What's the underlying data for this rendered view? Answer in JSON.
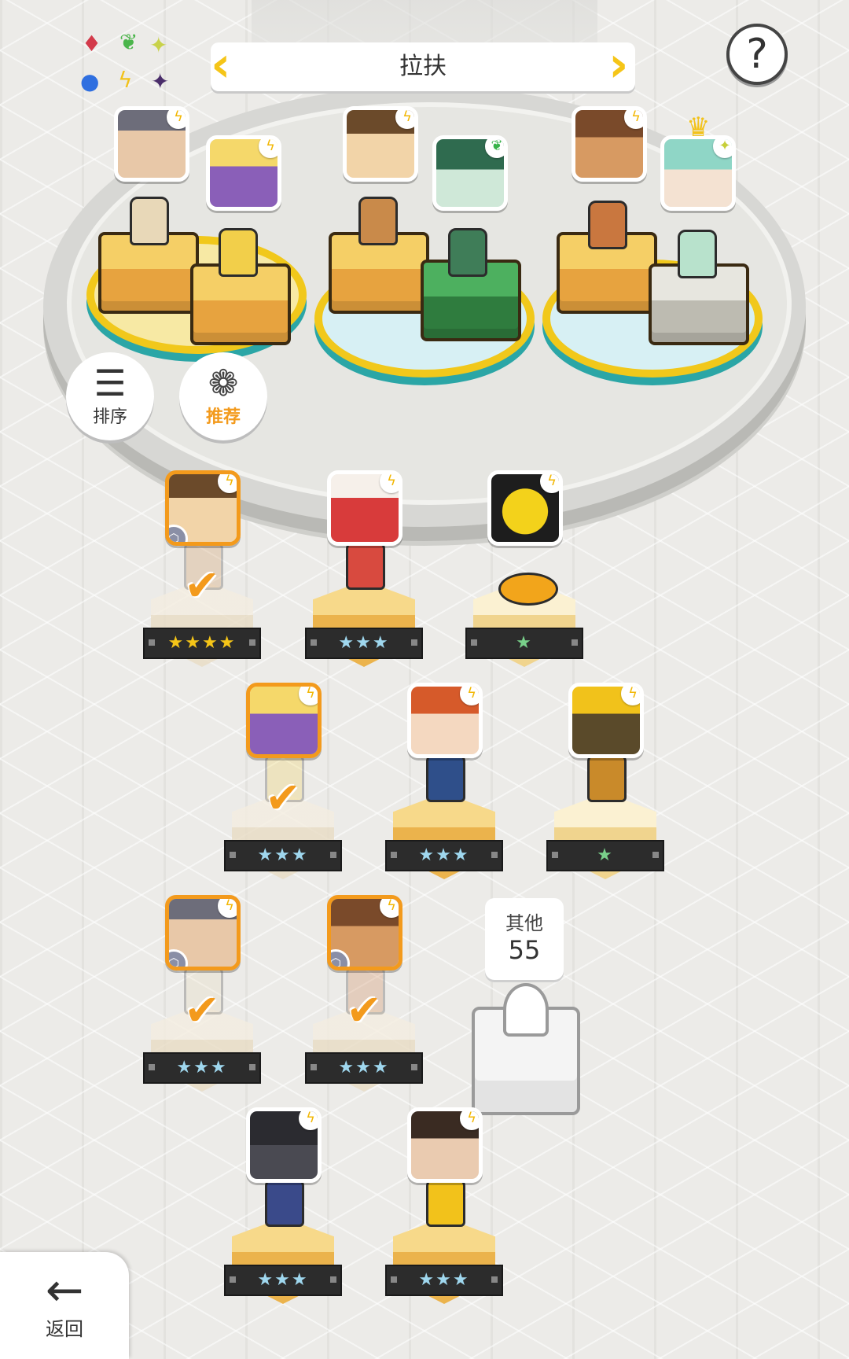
{
  "header": {
    "title": "拉扶",
    "help": "?"
  },
  "elements": [
    "fire",
    "wind",
    "light",
    "water",
    "thunder",
    "dark"
  ],
  "buttons": {
    "sort_label": "排序",
    "recommend_label": "推荐",
    "back_label": "返回"
  },
  "team": [
    {
      "slot": 1,
      "heroes": [
        "hero-elder-sage",
        "hero-blonde-girl"
      ]
    },
    {
      "slot": 2,
      "heroes": [
        "hero-captain-mustache",
        "hero-green-hair-lady"
      ]
    },
    {
      "slot": 3,
      "heroes": [
        "hero-glasses-girl",
        "hero-mint-hair-lady"
      ]
    }
  ],
  "roster": [
    {
      "name": "hero-captain-mustache",
      "stars": "★★★★",
      "selected": true
    },
    {
      "name": "hero-red-oni",
      "stars": "★★★",
      "selected": false
    },
    {
      "name": "hero-yellow-bird",
      "stars": "★",
      "selected": false
    },
    {
      "name": "hero-blonde-girl",
      "stars": "★★★",
      "selected": true
    },
    {
      "name": "hero-red-hair-girl",
      "stars": "★★★",
      "selected": false
    },
    {
      "name": "hero-lion",
      "stars": "★",
      "selected": false
    },
    {
      "name": "hero-elder-sage",
      "stars": "★★★",
      "selected": true
    },
    {
      "name": "hero-glasses-girl",
      "stars": "★★★",
      "selected": true
    },
    {
      "name": "hero-panther",
      "stars": "★★★",
      "selected": false
    },
    {
      "name": "hero-dark-hair-girl",
      "stars": "★★★",
      "selected": false
    }
  ],
  "others": {
    "label": "其他",
    "count": "55"
  },
  "colors": {
    "accent": "#f39a1c",
    "gold": "#f5c518",
    "ring": "#f1c81b",
    "teal": "#2ba6a6"
  }
}
